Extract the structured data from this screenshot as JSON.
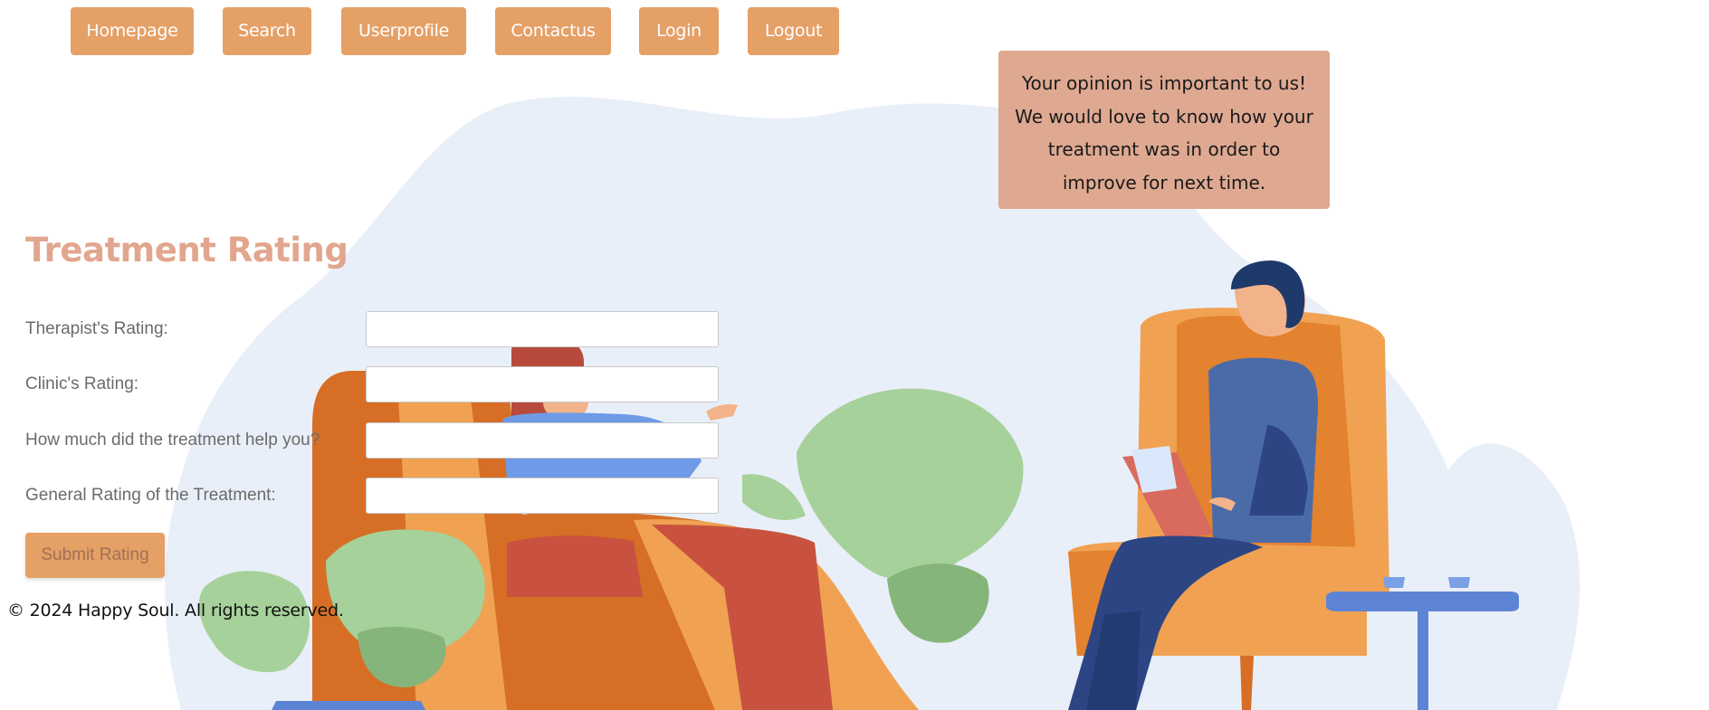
{
  "nav": {
    "items": [
      {
        "label": "Homepage"
      },
      {
        "label": "Search"
      },
      {
        "label": "Userprofile"
      },
      {
        "label": "Contactus"
      },
      {
        "label": "Login"
      },
      {
        "label": "Logout"
      }
    ]
  },
  "info_box": {
    "lines": [
      "Your opinion is important to us!",
      "We would love to know how your",
      "treatment was in order to",
      "improve for next time."
    ]
  },
  "form": {
    "title": "Treatment Rating",
    "fields": [
      {
        "label": "Therapist's Rating:",
        "value": ""
      },
      {
        "label": "Clinic's Rating:",
        "value": ""
      },
      {
        "label": "How much did the treatment help you?",
        "value": ""
      },
      {
        "label": "General Rating of the Treatment:",
        "value": ""
      }
    ],
    "submit_label": "Submit Rating"
  },
  "footer": {
    "text": "© 2024 Happy Soul. All rights reserved."
  },
  "colors": {
    "nav_button": "#e5a066",
    "info_box": "#dfa991",
    "title": "#e2a68e",
    "blob": "#e9eff9"
  }
}
